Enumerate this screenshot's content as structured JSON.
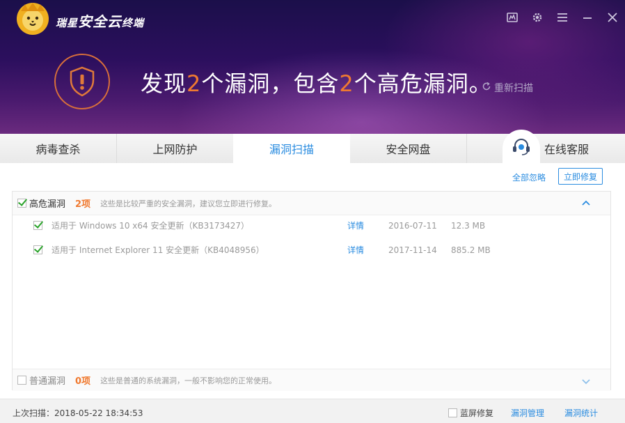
{
  "app": {
    "brand_small_1": "瑞星",
    "brand_big": "安全云",
    "brand_small_2": "终端"
  },
  "window_controls": [
    "report-icon",
    "gear-icon",
    "menu-icon",
    "minimize-icon",
    "close-icon"
  ],
  "summary": {
    "part1": "发现",
    "count1": "2",
    "part2": "个漏洞，包含",
    "count2": "2",
    "part3": "个高危漏洞。",
    "rescan_label": "重新扫描"
  },
  "tabs": [
    {
      "label": "病毒查杀",
      "active": false
    },
    {
      "label": "上网防护",
      "active": false
    },
    {
      "label": "漏洞扫描",
      "active": true
    },
    {
      "label": "安全网盘",
      "active": false
    }
  ],
  "service_label": "在线客服",
  "actions": {
    "ignore_all": "全部忽略",
    "fix_now": "立即修复"
  },
  "high_risk": {
    "title": "高危漏洞",
    "count": "2项",
    "desc": "这些是比较严重的安全漏洞，建议您立即进行修复。",
    "checked": true,
    "items": [
      {
        "name": "适用于 Windows 10 x64 安全更新（KB3173427）",
        "detail": "详情",
        "date": "2016-07-11",
        "size": "12.3 MB",
        "checked": true
      },
      {
        "name": "适用于 Internet Explorer 11 安全更新（KB4048956）",
        "detail": "详情",
        "date": "2017-11-14",
        "size": "885.2 MB",
        "checked": true
      }
    ]
  },
  "normal": {
    "title": "普通漏洞",
    "count": "0项",
    "desc": "这些是普通的系统漏洞，一般不影响您的正常使用。",
    "checked": false
  },
  "footer": {
    "last_scan": "上次扫描：2018-05-22 18:34:53",
    "bluescreen_fix": "蓝屏修复",
    "vuln_manage": "漏洞管理",
    "vuln_stats": "漏洞统计"
  },
  "colors": {
    "accent": "#2a8ce0",
    "warning": "#f07a30",
    "check": "#2aa32a"
  }
}
